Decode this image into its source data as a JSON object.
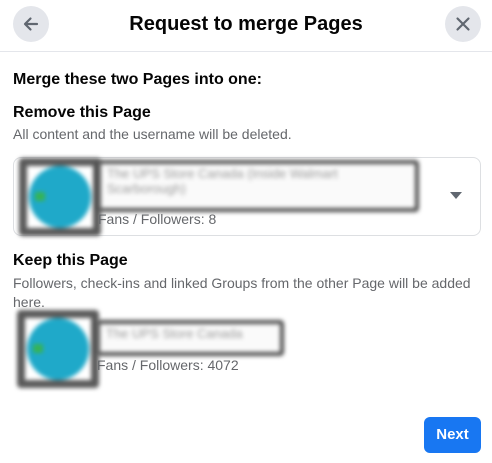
{
  "dialog": {
    "title": "Request to merge Pages",
    "back_icon": "arrow-left-icon",
    "close_icon": "close-icon"
  },
  "intro": "Merge these two Pages into one:",
  "remove_section": {
    "heading": "Remove this Page",
    "description": "All content and the username will be deleted.",
    "page": {
      "name": "The UPS Store Canada (Inside Walmart Scarborough)",
      "fans_label": "Fans / Followers: 8"
    },
    "dropdown_icon": "caret-down-icon"
  },
  "keep_section": {
    "heading": "Keep this Page",
    "description": "Followers, check-ins and linked Groups from the other Page will be added here.",
    "page": {
      "name": "The UPS Store Canada",
      "fans_label": "Fans / Followers: 4072"
    }
  },
  "next_button": "Next",
  "colors": {
    "primary": "#1877f2",
    "secondary_text": "#65676b",
    "icon_bg": "#e4e6eb"
  }
}
